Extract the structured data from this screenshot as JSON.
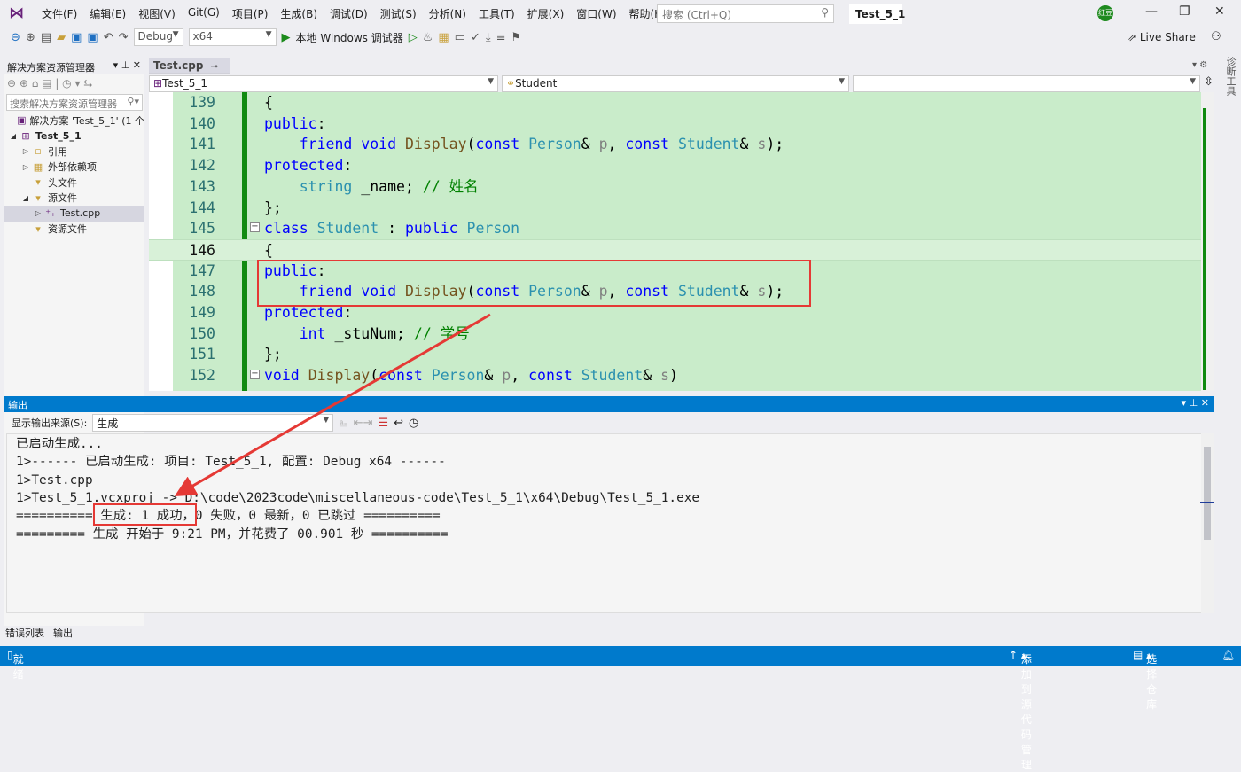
{
  "menu": [
    "文件(F)",
    "编辑(E)",
    "视图(V)",
    "Git(G)",
    "项目(P)",
    "生成(B)",
    "调试(D)",
    "测试(S)",
    "分析(N)",
    "工具(T)",
    "扩展(X)",
    "窗口(W)",
    "帮助(H)"
  ],
  "search_placeholder": "搜索 (Ctrl+Q)",
  "solution_title": "Test_5_1",
  "avatar_text": "红豆",
  "toolbar": {
    "config": "Debug",
    "platform": "x64",
    "run_label": "本地 Windows 调试器",
    "live_share": "Live Share"
  },
  "solution_explorer": {
    "title": "解决方案资源管理器",
    "search_placeholder": "搜索解决方案资源管理器",
    "items": [
      {
        "label": "解决方案 'Test_5_1' (1 个",
        "icon": "solution-icon",
        "twisty": ""
      },
      {
        "label": "Test_5_1",
        "icon": "project-icon",
        "twisty": "◢"
      },
      {
        "label": "引用",
        "icon": "references-icon",
        "twisty": "▷"
      },
      {
        "label": "外部依赖项",
        "icon": "external-deps-icon",
        "twisty": "▷"
      },
      {
        "label": "头文件",
        "icon": "filter-folder-icon",
        "twisty": ""
      },
      {
        "label": "源文件",
        "icon": "filter-folder-icon",
        "twisty": "◢"
      },
      {
        "label": "Test.cpp",
        "icon": "cpp-file-icon",
        "twisty": "▷"
      },
      {
        "label": "资源文件",
        "icon": "filter-folder-icon",
        "twisty": ""
      }
    ]
  },
  "editor": {
    "tab": "Test.cpp",
    "nav_project": "Test_5_1",
    "nav_scope": "Student",
    "nav_member": "",
    "current_line": 146,
    "lines": [
      {
        "n": "139",
        "t": [
          [
            "{",
            "tx"
          ]
        ]
      },
      {
        "n": "140",
        "t": [
          [
            "public",
            "kw"
          ],
          [
            ":",
            "tx"
          ]
        ]
      },
      {
        "n": "141",
        "t": [
          [
            "    ",
            "tx"
          ],
          [
            "friend",
            "kw"
          ],
          [
            " ",
            "tx"
          ],
          [
            "void",
            "kw"
          ],
          [
            " ",
            "tx"
          ],
          [
            "Display",
            "fn"
          ],
          [
            "(",
            "tx"
          ],
          [
            "const",
            "kw"
          ],
          [
            " ",
            "tx"
          ],
          [
            "Person",
            "ty"
          ],
          [
            "& ",
            "tx"
          ],
          [
            "p",
            "pa"
          ],
          [
            ", ",
            "tx"
          ],
          [
            "const",
            "kw"
          ],
          [
            " ",
            "tx"
          ],
          [
            "Student",
            "ty"
          ],
          [
            "& ",
            "tx"
          ],
          [
            "s",
            "pa"
          ],
          [
            ");",
            "tx"
          ]
        ]
      },
      {
        "n": "142",
        "t": [
          [
            "protected",
            "kw"
          ],
          [
            ":",
            "tx"
          ]
        ]
      },
      {
        "n": "143",
        "t": [
          [
            "    ",
            "tx"
          ],
          [
            "string",
            "ty"
          ],
          [
            " _name; ",
            "tx"
          ],
          [
            "// 姓名",
            "cm"
          ]
        ]
      },
      {
        "n": "144",
        "t": [
          [
            "};",
            "tx"
          ]
        ]
      },
      {
        "n": "145",
        "fold": true,
        "t": [
          [
            "class",
            "kw"
          ],
          [
            " ",
            "tx"
          ],
          [
            "Student",
            "ty"
          ],
          [
            " : ",
            "tx"
          ],
          [
            "public",
            "kw"
          ],
          [
            " ",
            "tx"
          ],
          [
            "Person",
            "ty"
          ]
        ]
      },
      {
        "n": "146",
        "t": [
          [
            "{",
            "tx"
          ]
        ]
      },
      {
        "n": "147",
        "t": [
          [
            "public",
            "kw"
          ],
          [
            ":",
            "tx"
          ]
        ]
      },
      {
        "n": "148",
        "t": [
          [
            "    ",
            "tx"
          ],
          [
            "friend",
            "kw"
          ],
          [
            " ",
            "tx"
          ],
          [
            "void",
            "kw"
          ],
          [
            " ",
            "tx"
          ],
          [
            "Display",
            "fn"
          ],
          [
            "(",
            "tx"
          ],
          [
            "const",
            "kw"
          ],
          [
            " ",
            "tx"
          ],
          [
            "Person",
            "ty"
          ],
          [
            "& ",
            "tx"
          ],
          [
            "p",
            "pa"
          ],
          [
            ", ",
            "tx"
          ],
          [
            "const",
            "kw"
          ],
          [
            " ",
            "tx"
          ],
          [
            "Student",
            "ty"
          ],
          [
            "& ",
            "tx"
          ],
          [
            "s",
            "pa"
          ],
          [
            ");",
            "tx"
          ]
        ]
      },
      {
        "n": "149",
        "t": [
          [
            "protected",
            "kw"
          ],
          [
            ":",
            "tx"
          ]
        ]
      },
      {
        "n": "150",
        "t": [
          [
            "    ",
            "tx"
          ],
          [
            "int",
            "kw"
          ],
          [
            " _stuNum; ",
            "tx"
          ],
          [
            "// 学号",
            "cm"
          ]
        ]
      },
      {
        "n": "151",
        "t": [
          [
            "};",
            "tx"
          ]
        ]
      },
      {
        "n": "152",
        "fold": true,
        "t": [
          [
            "void",
            "kw"
          ],
          [
            " ",
            "tx"
          ],
          [
            "Display",
            "fn"
          ],
          [
            "(",
            "tx"
          ],
          [
            "const",
            "kw"
          ],
          [
            " ",
            "tx"
          ],
          [
            "Person",
            "ty"
          ],
          [
            "& ",
            "tx"
          ],
          [
            "p",
            "pa"
          ],
          [
            ", ",
            "tx"
          ],
          [
            "const",
            "kw"
          ],
          [
            " ",
            "tx"
          ],
          [
            "Student",
            "ty"
          ],
          [
            "& ",
            "tx"
          ],
          [
            "s",
            "pa"
          ],
          [
            ")",
            "tx"
          ]
        ]
      }
    ]
  },
  "output": {
    "title": "输出",
    "source_label": "显示输出来源(S):",
    "source_value": "生成",
    "lines": [
      "已启动生成...",
      "1>------ 已启动生成: 项目: Test_5_1, 配置: Debug x64 ------",
      "1>Test.cpp",
      "1>Test_5_1.vcxproj -> D:\\code\\2023code\\miscellaneous-code\\Test_5_1\\x64\\Debug\\Test_5_1.exe",
      "========== 生成: 1 成功，0 失败，0 最新，0 已跳过 ==========",
      "========= 生成 开始于 9:21 PM，并花费了 00.901 秒 =========="
    ]
  },
  "bottom_tabs": [
    "错误列表",
    "输出"
  ],
  "status": {
    "ready": "就绪",
    "add_source": "添加到源代码管理",
    "select_repo": "选择仓库"
  },
  "colors": {
    "accent": "#007acc",
    "annotation": "#e53935",
    "code_bg": "#c9ecca"
  }
}
